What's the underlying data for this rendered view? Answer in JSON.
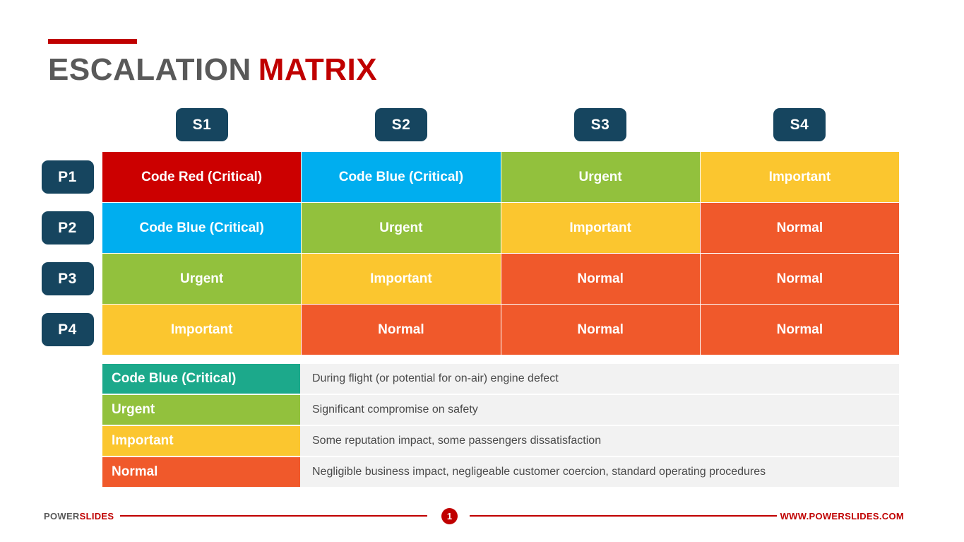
{
  "title": {
    "main": "ESCALATION",
    "accent": "MATRIX"
  },
  "colors": {
    "navy": "#16455F",
    "red": "#C00000",
    "code_red": "#CC0000",
    "code_blue": "#00AEEF",
    "urgent_green": "#92C13D",
    "important_yellow": "#FBC62F",
    "normal_orange": "#F0592B",
    "legend_teal": "#1CA98B",
    "desc_bg": "#F2F2F2",
    "title_gray": "#595959"
  },
  "matrix": {
    "column_headers": [
      "S1",
      "S2",
      "S3",
      "S4"
    ],
    "row_headers": [
      "P1",
      "P2",
      "P3",
      "P4"
    ],
    "rows": [
      {
        "label": "P1",
        "cells": [
          {
            "text": "Code Red (Critical)",
            "color": "#CC0000"
          },
          {
            "text": "Code Blue (Critical)",
            "color": "#00AEEF"
          },
          {
            "text": "Urgent",
            "color": "#92C13D"
          },
          {
            "text": "Important",
            "color": "#FBC62F"
          }
        ]
      },
      {
        "label": "P2",
        "cells": [
          {
            "text": "Code Blue (Critical)",
            "color": "#00AEEF"
          },
          {
            "text": "Urgent",
            "color": "#92C13D"
          },
          {
            "text": "Important",
            "color": "#FBC62F"
          },
          {
            "text": "Normal",
            "color": "#F0592B"
          }
        ]
      },
      {
        "label": "P3",
        "cells": [
          {
            "text": "Urgent",
            "color": "#92C13D"
          },
          {
            "text": "Important",
            "color": "#FBC62F"
          },
          {
            "text": "Normal",
            "color": "#F0592B"
          },
          {
            "text": "Normal",
            "color": "#F0592B"
          }
        ]
      },
      {
        "label": "P4",
        "cells": [
          {
            "text": "Important",
            "color": "#FBC62F"
          },
          {
            "text": "Normal",
            "color": "#F0592B"
          },
          {
            "text": "Normal",
            "color": "#F0592B"
          },
          {
            "text": "Normal",
            "color": "#F0592B"
          }
        ]
      }
    ]
  },
  "legend": [
    {
      "label": "Code Blue (Critical)",
      "color": "#1CA98B",
      "description": "During flight (or potential for on-air) engine defect"
    },
    {
      "label": "Urgent",
      "color": "#92C13D",
      "description": "Significant compromise on safety"
    },
    {
      "label": "Important",
      "color": "#FBC62F",
      "description": "Some reputation impact, some passengers dissatisfaction"
    },
    {
      "label": "Normal",
      "color": "#F0592B",
      "description": "Negligible business impact, negligeable customer coercion, standard operating procedures"
    }
  ],
  "footer": {
    "brand_first": "POWER",
    "brand_second": "SLIDES",
    "page_number": "1",
    "website": "WWW.POWERSLIDES.COM"
  }
}
